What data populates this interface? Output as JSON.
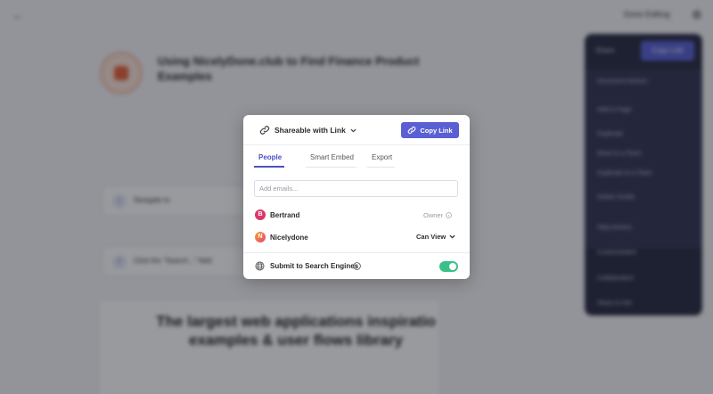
{
  "background": {
    "top_bar": {
      "done_editing": "Done Editing"
    },
    "guide": {
      "title": "Using NicelyDone.club to Find Finance Product Examples"
    },
    "steps": [
      {
        "number": "1",
        "text": "Navigate to"
      },
      {
        "number": "2",
        "text": "Click the \"Search...\" field"
      }
    ],
    "hero": {
      "title": "The largest web applications inspiratio examples & user flows library"
    },
    "side_panel": {
      "share_label": "Share",
      "copy_label": "Copy Link",
      "items": [
        "Document Actions",
        "Add to Page",
        "Duplicate",
        "Move to a Team",
        "Duplicate to a Team",
        "Delete Scribe",
        "Step Actions",
        "Customization",
        "Collaboration",
        "Share & Info"
      ]
    }
  },
  "modal": {
    "share_mode": "Shareable with Link",
    "copy_button": "Copy Link",
    "tabs": [
      {
        "label": "People",
        "active": true
      },
      {
        "label": "Smart Embed",
        "active": false
      },
      {
        "label": "Export",
        "active": false
      }
    ],
    "email_placeholder": "Add emails...",
    "people": [
      {
        "initial": "B",
        "name": "Bertrand",
        "role": "Owner"
      },
      {
        "initial": "N",
        "name": "Nicelydone",
        "permission": "Can View"
      }
    ],
    "search_engines": {
      "label": "Submit to Search Engines",
      "enabled": true
    }
  },
  "colors": {
    "accent": "#5a5fd3",
    "toggle_on": "#3cc08a",
    "overlay": "rgba(12,14,24,0.42)"
  }
}
